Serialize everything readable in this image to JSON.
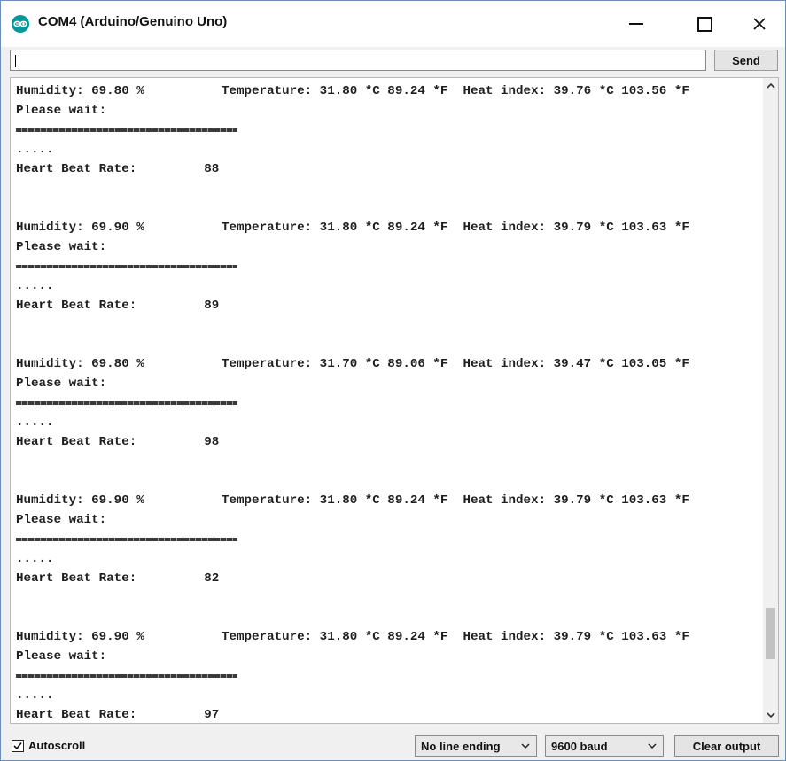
{
  "window": {
    "title": "COM4 (Arduino/Genuino Uno)",
    "icon": "arduino-icon"
  },
  "controls": {
    "minimize": "minimize-icon",
    "maximize": "maximize-icon",
    "close": "close-icon"
  },
  "send_bar": {
    "input_value": "",
    "send_label": "Send"
  },
  "output": {
    "blocks": [
      {
        "humidity": "Humidity: 69.80 %",
        "temperature": "Temperature: 31.80 *C 89.24 *F  Heat index: 39.76 *C 103.56 *F",
        "wait": "Please wait:",
        "dots": ".....",
        "hb_label": "Heart Beat Rate:",
        "hb_value": "88"
      },
      {
        "humidity": "Humidity: 69.90 %",
        "temperature": "Temperature: 31.80 *C 89.24 *F  Heat index: 39.79 *C 103.63 *F",
        "wait": "Please wait:",
        "dots": ".....",
        "hb_label": "Heart Beat Rate:",
        "hb_value": "89"
      },
      {
        "humidity": "Humidity: 69.80 %",
        "temperature": "Temperature: 31.70 *C 89.06 *F  Heat index: 39.47 *C 103.05 *F",
        "wait": "Please wait:",
        "dots": ".....",
        "hb_label": "Heart Beat Rate:",
        "hb_value": "98"
      },
      {
        "humidity": "Humidity: 69.90 %",
        "temperature": "Temperature: 31.80 *C 89.24 *F  Heat index: 39.79 *C 103.63 *F",
        "wait": "Please wait:",
        "dots": ".....",
        "hb_label": "Heart Beat Rate:",
        "hb_value": "82"
      },
      {
        "humidity": "Humidity: 69.90 %",
        "temperature": "Temperature: 31.80 *C 89.24 *F  Heat index: 39.79 *C 103.63 *F",
        "wait": "Please wait:",
        "dots": ".....",
        "hb_label": "Heart Beat Rate:",
        "hb_value": "97"
      }
    ]
  },
  "bottom_bar": {
    "autoscroll_label": "Autoscroll",
    "autoscroll_checked": true,
    "line_ending": "No line ending",
    "baud": "9600 baud",
    "clear_label": "Clear output"
  }
}
